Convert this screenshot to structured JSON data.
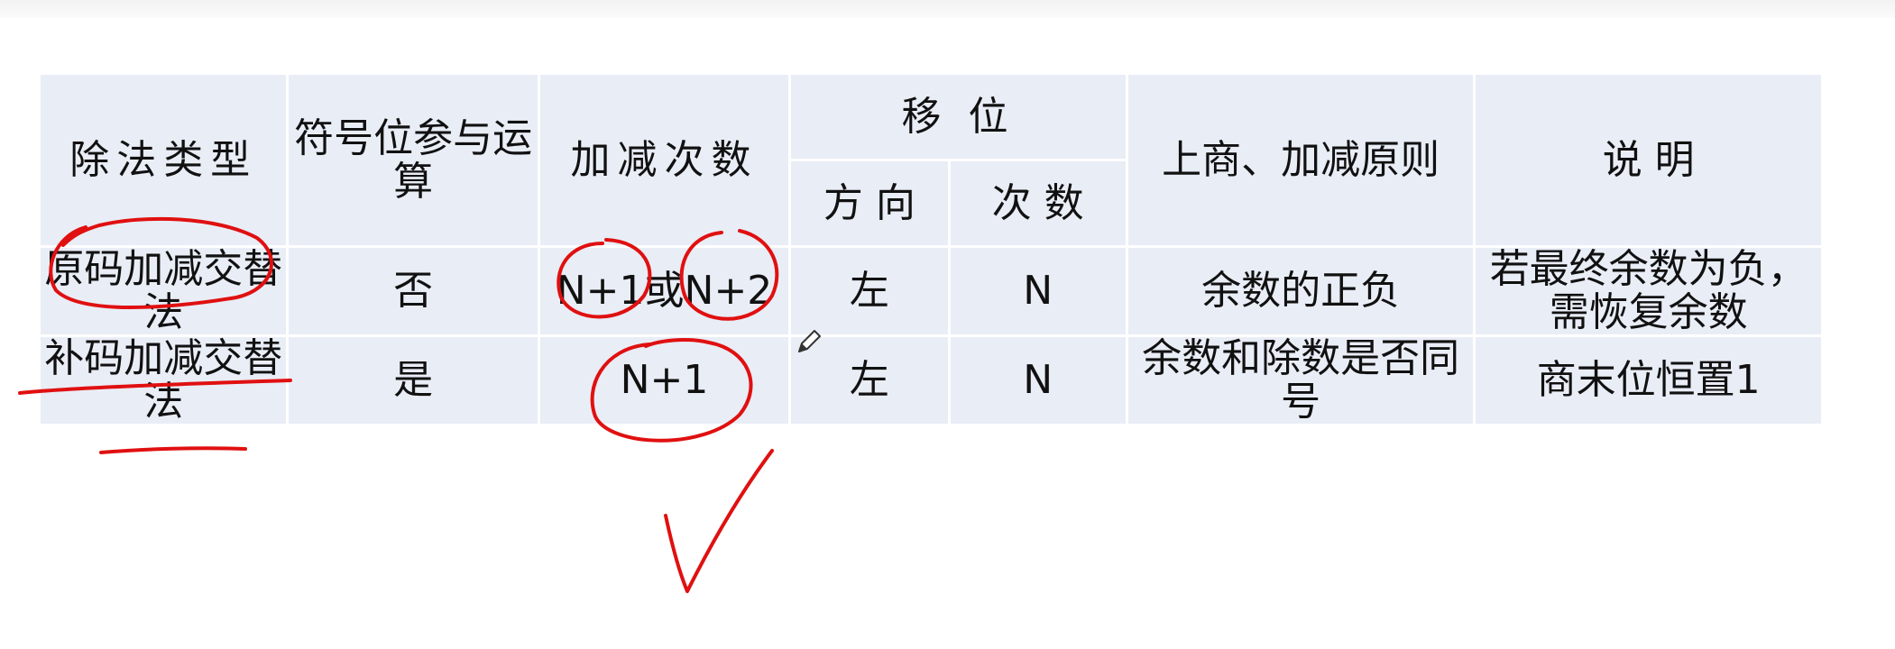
{
  "table": {
    "headers": {
      "division_type": "除法类型",
      "sign_bit": "符号位参与运算",
      "add_sub_count": "加减次数",
      "shift": "移 位",
      "direction": "方 向",
      "times": "次 数",
      "rule": "上商、加减原则",
      "note": "说 明"
    },
    "rows": [
      {
        "division_type": "原码加减交替法",
        "sign_bit": "否",
        "add_sub_count": "N+1或N+2",
        "direction": "左",
        "times": "N",
        "rule": "余数的正负",
        "note": "若最终余数为负，需恢复余数"
      },
      {
        "division_type": "补码加减交替法",
        "sign_bit": "是",
        "add_sub_count": "N+1",
        "direction": "左",
        "times": "N",
        "rule": "余数和除数是否同号",
        "note": "商末位恒置1"
      }
    ]
  },
  "annotations": {
    "ink_color": "#e01010"
  }
}
